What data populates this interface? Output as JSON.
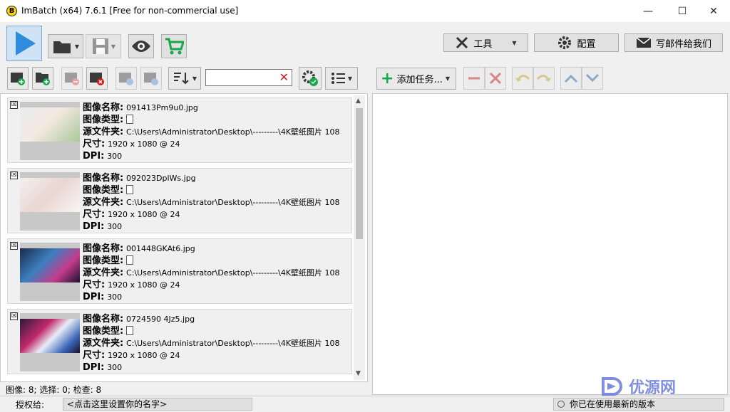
{
  "window": {
    "title": "ImBatch (x64) 7.6.1 [Free for non-commercial use]",
    "logo_letter": "B",
    "minimize": "—",
    "maximize": "☐",
    "close": "✕"
  },
  "toolbar": {
    "tools_label": "工具",
    "config_label": "配置",
    "mail_label": "写邮件给我们"
  },
  "task_toolbar": {
    "add_task_label": "添加任务..."
  },
  "search": {
    "value": "",
    "clear_glyph": "✕"
  },
  "images": [
    {
      "name_label": "图像名称:",
      "name": "091413Pm9u0.jpg",
      "type_label": "图像类型:",
      "folder_label": "源文件夹:",
      "folder": "C:\\Users\\Administrator\\Desktop\\---------\\4K壁纸图片 108",
      "size_label": "尺寸:",
      "size": "1920 x 1080 @ 24",
      "dpi_label": "DPI:",
      "dpi": "300",
      "checked": "☒"
    },
    {
      "name_label": "图像名称:",
      "name": "092023DplWs.jpg",
      "type_label": "图像类型:",
      "folder_label": "源文件夹:",
      "folder": "C:\\Users\\Administrator\\Desktop\\---------\\4K壁纸图片 108",
      "size_label": "尺寸:",
      "size": "1920 x 1080 @ 24",
      "dpi_label": "DPI:",
      "dpi": "300",
      "checked": "☒"
    },
    {
      "name_label": "图像名称:",
      "name": "001448GKAt6.jpg",
      "type_label": "图像类型:",
      "folder_label": "源文件夹:",
      "folder": "C:\\Users\\Administrator\\Desktop\\---------\\4K壁纸图片 108",
      "size_label": "尺寸:",
      "size": "1920 x 1080 @ 24",
      "dpi_label": "DPI:",
      "dpi": "300",
      "checked": "☒"
    },
    {
      "name_label": "图像名称:",
      "name": "0724590 4Jz5.jpg",
      "type_label": "图像类型:",
      "folder_label": "源文件夹:",
      "folder": "C:\\Users\\Administrator\\Desktop\\---------\\4K壁纸图片 108",
      "size_label": "尺寸:",
      "size": "1920 x 1080 @ 24",
      "dpi_label": "DPI:",
      "dpi": "300",
      "checked": "☒"
    }
  ],
  "status": {
    "summary": "图像: 8; 选择: 0; 检查: 8",
    "license_label": "授权给:",
    "license_value": "<点击这里设置你的名字>",
    "version_text": "你已在使用最新的版本"
  },
  "watermark": {
    "text": "优源网"
  },
  "colors": {
    "accent": "#2e8bde",
    "cart_green": "#1aa64b",
    "delete_red": "#d21d1d"
  }
}
